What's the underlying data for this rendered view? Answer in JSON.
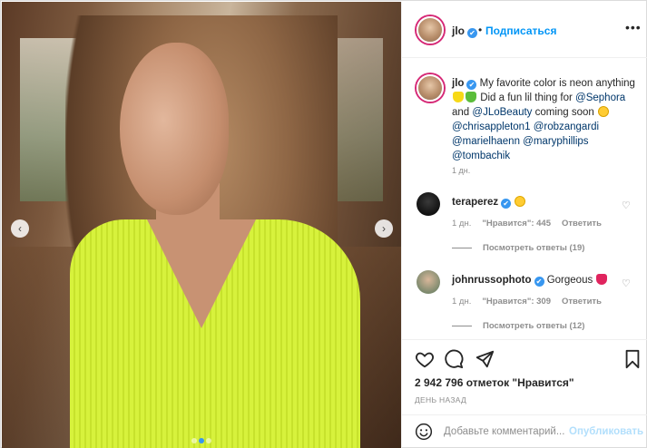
{
  "post": {
    "nav_prev": "‹",
    "nav_next": "›",
    "carousel_count": 3,
    "carousel_active": 2
  },
  "header": {
    "username": "jlo",
    "verified_mark": "✔",
    "separator": "•",
    "follow_label": "Подписаться",
    "more_label": "•••"
  },
  "caption": {
    "username": "jlo",
    "verified_mark": "✔",
    "text_1": " My favorite color is neon anything ",
    "text_2": " Did a fun lil thing for ",
    "mention_1": "@Sephora",
    "and": " and ",
    "mention_2": "@JLoBeauty",
    "text_3": " coming soon ",
    "mention_3": "@chrisappleton1",
    "mention_4": "@robzangardi",
    "mention_5": "@marielhaenn",
    "mention_6": "@maryphillips",
    "mention_7": "@tombachik",
    "time": "1 дн."
  },
  "comments": [
    {
      "username": "teraperez",
      "verified_mark": "✔",
      "text": "",
      "time": "1 дн.",
      "likes_label": "\"Нравится\": 445",
      "reply_label": "Ответить",
      "replies_label": "Посмотреть ответы (19)"
    },
    {
      "username": "johnrussophoto",
      "verified_mark": "✔",
      "text": "Gorgeous",
      "time": "1 дн.",
      "likes_label": "\"Нравится\": 309",
      "reply_label": "Ответить",
      "replies_label": "Посмотреть ответы (12)"
    }
  ],
  "actions": {
    "likes_text": "2 942 796 отметок \"Нравится\"",
    "when": "ДЕНЬ НАЗАД"
  },
  "add_comment": {
    "placeholder": "Добавьте комментарий...",
    "post_label": "Опубликовать"
  },
  "icons": {
    "like": "heart-outline-icon",
    "comment": "comment-bubble-icon",
    "share": "paper-plane-icon",
    "save": "bookmark-icon",
    "emoji": "smiley-icon"
  },
  "colors": {
    "link": "#00376b",
    "accent": "#0095f6",
    "muted": "#8e8e8e",
    "post_disabled": "#b2dffc"
  }
}
